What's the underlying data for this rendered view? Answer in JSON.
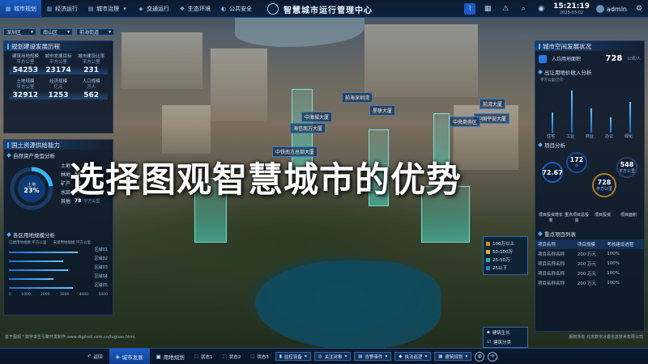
{
  "topnav": {
    "items": [
      {
        "label": "城市规划",
        "icon": "city-icon",
        "active": true
      },
      {
        "label": "经济运行",
        "icon": "chart-icon",
        "active": false
      },
      {
        "label": "城市治理",
        "icon": "governance-icon",
        "active": false
      },
      {
        "label": "交通运行",
        "icon": "traffic-icon",
        "active": false
      },
      {
        "label": "生态环境",
        "icon": "leaf-icon",
        "active": false
      },
      {
        "label": "公共安全",
        "icon": "shield-icon",
        "active": false
      }
    ],
    "title": "智慧城市运行管理中心",
    "time": "15:21:19",
    "date": "2023-03-02",
    "user": "admin"
  },
  "filters": [
    "深圳区",
    "南山区",
    "前海街道"
  ],
  "left": {
    "panel1_title": "规划建设发展历程",
    "stats": [
      {
        "label": "建筑用地规模",
        "unit": "平方公里",
        "value": "54253"
      },
      {
        "label": "城市发展目标",
        "unit": "平方公里",
        "value": "23174"
      },
      {
        "label": "城市建设比率",
        "unit": "平方公里",
        "value": "231"
      },
      {
        "label": "土地规模",
        "unit": "平方公里",
        "value": "32912"
      },
      {
        "label": "经济规模",
        "unit": "亿元",
        "value": "1253"
      },
      {
        "label": "人口规模",
        "unit": "万人",
        "value": "562"
      }
    ],
    "panel2_title": "国土资源供给能力",
    "sub1": "自然资产类型分析",
    "donut": {
      "label": "土地",
      "value": "23%",
      "fraction": 0.23
    },
    "legend": [
      {
        "name": "土地",
        "value": "",
        "unit": ""
      },
      {
        "name": "林地",
        "value": "56",
        "unit": "平方公里"
      },
      {
        "name": "矿产",
        "value": "24",
        "unit": "平方公里"
      },
      {
        "name": "水田",
        "value": "46",
        "unit": "平方公里"
      },
      {
        "name": "其他",
        "value": "78",
        "unit": "平方公里"
      }
    ],
    "sub2": "各区用地规模分析",
    "hbar_legend": [
      "已建用地规模 平方公里",
      "未建用地规模 平方公里"
    ],
    "hbars": [
      {
        "name": "区域01",
        "value": 0.7
      },
      {
        "name": "区域02",
        "value": 0.55
      },
      {
        "name": "区域03",
        "value": 0.6
      },
      {
        "name": "区域04",
        "value": 0.45
      },
      {
        "name": "区域05",
        "value": 0.65
      }
    ],
    "hbar_axis": [
      "0",
      "1000",
      "2000",
      "3000",
      "4000",
      "5000"
    ]
  },
  "right": {
    "panel_title": "城市空间发展状况",
    "area_label": "人均用地面积",
    "area_value": "728",
    "area_unit": "公顷/人",
    "sub1": "出让用地价收入分析",
    "vbar_unit": "平方公里/万元",
    "vbars": [
      {
        "name": "住宅",
        "value": 0.45
      },
      {
        "name": "工业",
        "value": 0.95
      },
      {
        "name": "商业",
        "value": 0.55
      },
      {
        "name": "办公",
        "value": 0.35
      },
      {
        "name": "绿化",
        "value": 0.7
      }
    ],
    "sub2": "项目分析",
    "bubbles": [
      {
        "value": "72.67",
        "unit": ""
      },
      {
        "value": "172",
        "unit": "个"
      },
      {
        "value": "728",
        "unit": "平方公里"
      },
      {
        "value": "548",
        "unit": "平方公里"
      }
    ],
    "bubble_labels": [
      "项目投资增长率",
      "重点项目总投资",
      "项目投资",
      "项目面积"
    ],
    "sub3": "重点项目列表",
    "table_headers": [
      "项目名称",
      "项目规模",
      "考核建设进程"
    ],
    "table_rows": [
      [
        "项目名称名称",
        "200 万元",
        "100%"
      ],
      [
        "项目名称名称",
        "200 万元",
        "100%"
      ],
      [
        "项目名称名称",
        "200 万元",
        "100%"
      ],
      [
        "项目名称名称",
        "200 万元",
        "100%"
      ]
    ]
  },
  "map_tags": [
    "中海城大厦",
    "前海深圳湾",
    "星联大厦",
    "中国平安大厦",
    "前湾大厦",
    "中央商务区",
    "海信南方大厦",
    "中铁南方总部大厦"
  ],
  "headline": "选择图观智慧城市的优势",
  "map_legend": [
    {
      "label": "100万以上",
      "color": "#c98a2a"
    },
    {
      "label": "50-100万",
      "color": "#d6b33a"
    },
    {
      "label": "25-50万",
      "color": "#2bb39a"
    },
    {
      "label": "25以下",
      "color": "#2b7fd6"
    }
  ],
  "layer_pop": [
    "建筑生长",
    "建筑分类"
  ],
  "footer_left": "基于图观™数字孪生引擎开发制作 www.digihail.com.cn/tuguan.html",
  "footer_right": "版权所有 北京数字冰雹信息技术有限公司",
  "bottombar": {
    "back": "返回",
    "tabs": [
      {
        "label": "城市发展",
        "active": true
      },
      {
        "label": "用地规划",
        "active": false
      }
    ],
    "states": [
      "状态1",
      "状态2",
      "状态3"
    ],
    "chips": [
      "监控设备",
      "关注对象",
      "告警事件",
      "执法巡逻",
      "建筑规划"
    ]
  }
}
